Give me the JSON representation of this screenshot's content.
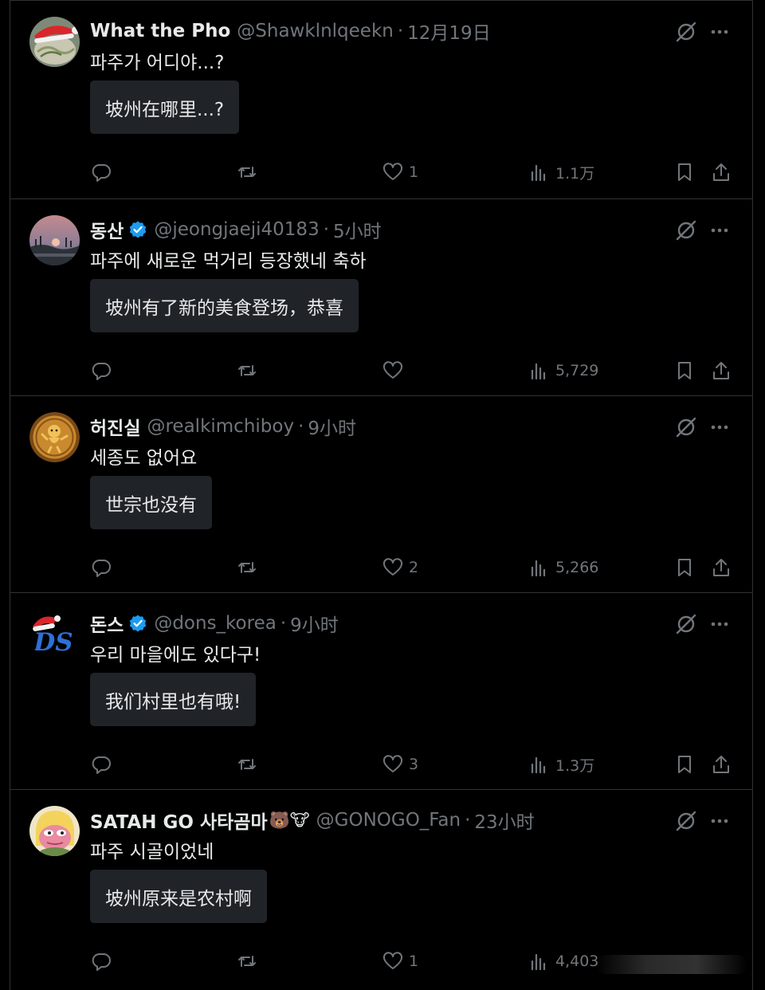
{
  "tweets": [
    {
      "name": "What the Pho",
      "verified": false,
      "handle": "@Shawklnlqeekn",
      "separator": "·",
      "time": "12月19日",
      "text": "파주가 어디야...?",
      "translation": "坡州在哪里...?",
      "likes": "1",
      "views": "1.1万",
      "avatar": "santa-hat-noodles",
      "has_bookmark": true
    },
    {
      "name": "동산",
      "verified": true,
      "handle": "@jeongjaeji40183",
      "separator": "·",
      "time": "5小时",
      "text": "파주에 새로운 먹거리 등장했네 축하",
      "translation": "坡州有了新的美食登场，恭喜",
      "likes": "",
      "views": "5,729",
      "avatar": "sunset-landscape",
      "has_bookmark": true
    },
    {
      "name": "허진실",
      "verified": false,
      "handle": "@realkimchiboy",
      "separator": "·",
      "time": "9小时",
      "text": "세종도 없어요",
      "translation": "世宗也没有",
      "likes": "2",
      "views": "5,266",
      "avatar": "gold-coin-figure",
      "has_bookmark": true
    },
    {
      "name": "돈스",
      "verified": true,
      "handle": "@dons_korea",
      "separator": "·",
      "time": "9小时",
      "text": "우리 마을에도 있다구!",
      "translation": "我们村里也有哦!",
      "likes": "3",
      "views": "1.3万",
      "avatar": "ds-logo-santa-hat",
      "has_bookmark": true
    },
    {
      "name": "SATAH GO 사타곰마",
      "name_emojis": "🐻🐮",
      "verified": false,
      "handle": "@GONOGO_Fan",
      "separator": "·",
      "time": "23小时",
      "text": "파주 시골이었네",
      "translation": "坡州原来是农村啊",
      "likes": "1",
      "views": "4,403",
      "avatar": "pink-frog-blonde",
      "has_bookmark": false
    }
  ],
  "icons": {
    "reply": "reply-icon",
    "retweet": "retweet-icon",
    "like": "heart-icon",
    "views": "views-icon",
    "bookmark": "bookmark-icon",
    "share": "share-icon",
    "grok": "grok-icon",
    "more": "more-icon"
  },
  "colors": {
    "background": "#000000",
    "text": "#e7e9ea",
    "muted": "#71767b",
    "border": "#2f3336",
    "translation_bg": "#202327",
    "verified": "#1d9bf0"
  }
}
